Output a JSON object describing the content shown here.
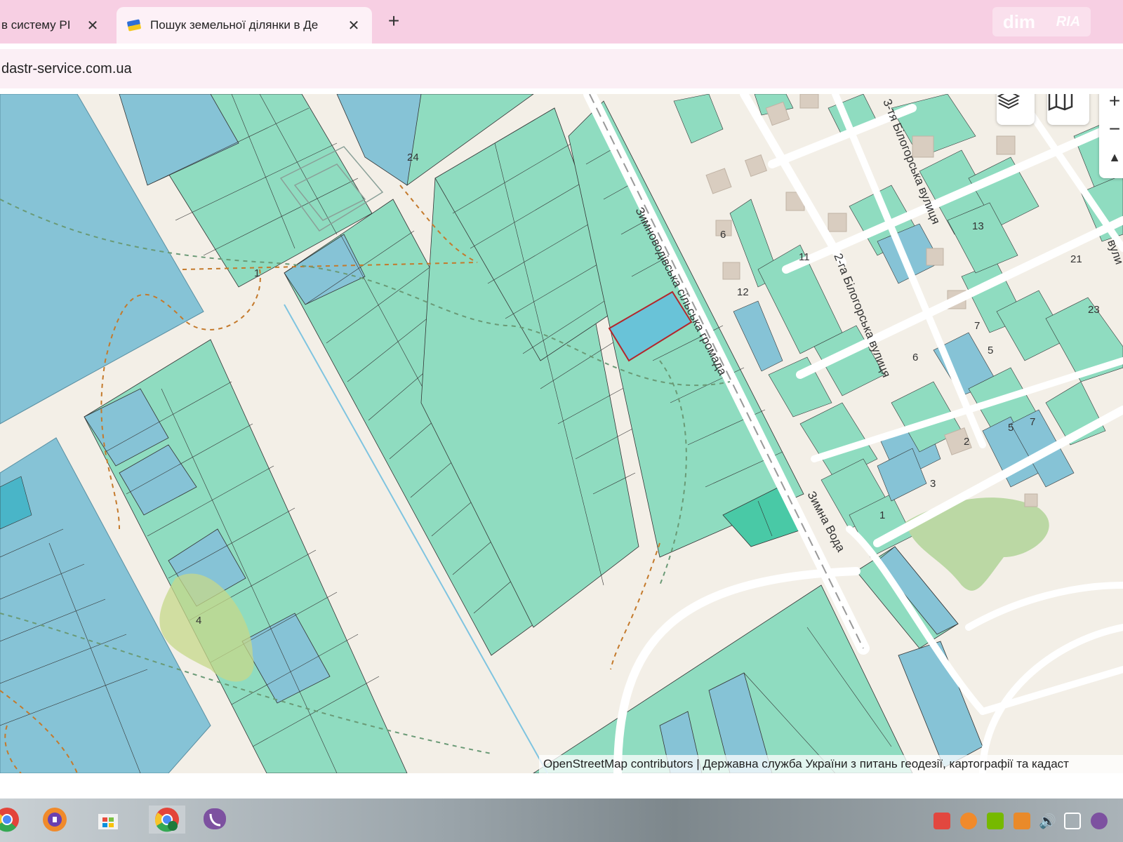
{
  "browser": {
    "tabs": [
      {
        "title": "в систему РІ",
        "close_label": "✕"
      },
      {
        "title": "Пошук земельної ділянки в Де",
        "close_label": "✕"
      }
    ],
    "new_tab_label": "+",
    "brand_dim": "dim",
    "brand_ria": "RIA",
    "url": "dastr-service.com.ua"
  },
  "map": {
    "street_labels": [
      "Зимноводівська сільська громада",
      "3-тя Білогорська вулиця",
      "2-га Білогорська вулиця",
      "Зимна Вода",
      "вули"
    ],
    "house_numbers": [
      "6",
      "12",
      "11",
      "13",
      "21",
      "23",
      "7",
      "6",
      "5",
      "2",
      "3",
      "1",
      "5",
      "7",
      "24",
      "1",
      "4"
    ],
    "controls": {
      "zoom_in": "+",
      "zoom_out": "−",
      "compass": "▲"
    },
    "layers_icon": "layers-icon",
    "map_icon": "map-book-icon",
    "attribution": "OpenStreetMap contributors | Державна служба України з питань геодезії, картографії та кадаст"
  },
  "colors": {
    "parcel_green": "#8fdcc0",
    "parcel_blue": "#86c3d6",
    "selected_parcel": "#69c3d8",
    "selected_border": "#b3262b",
    "road": "#f3efe7",
    "tab_bar": "#f7cfe3"
  },
  "taskbar": {
    "icons": [
      "chrome-icon",
      "avast-secure-browser-icon",
      "windows-store-icon",
      "chrome-profile-icon",
      "viber-icon"
    ],
    "tray_icons": [
      "anydesk-icon",
      "avast-icon",
      "nvidia-icon",
      "tray-app-icon",
      "volume-icon",
      "network-icon",
      "viber-tray-icon"
    ]
  }
}
